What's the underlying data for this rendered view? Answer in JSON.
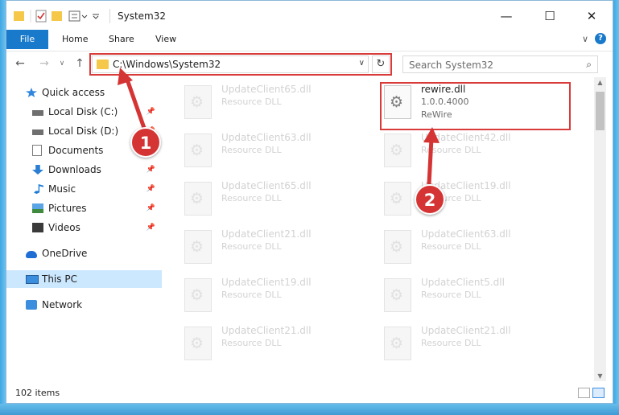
{
  "window": {
    "title": "System32",
    "minimize": "—",
    "maximize": "☐",
    "close": "✕"
  },
  "ribbon": {
    "tabs": [
      "File",
      "Home",
      "Share",
      "View"
    ],
    "expand": "∨",
    "help": "?"
  },
  "address": {
    "path": "C:\\Windows\\System32",
    "search_placeholder": "Search System32"
  },
  "navigation": [
    {
      "label": "Quick access",
      "icon": "star-icon"
    },
    {
      "label": "Local Disk (C:)",
      "icon": "drive-icon",
      "pinned": true
    },
    {
      "label": "Local Disk (D:)",
      "icon": "drive-icon",
      "pinned": true
    },
    {
      "label": "Documents",
      "icon": "document-icon",
      "pinned": true
    },
    {
      "label": "Downloads",
      "icon": "download-icon",
      "pinned": true
    },
    {
      "label": "Music",
      "icon": "music-icon",
      "pinned": true
    },
    {
      "label": "Pictures",
      "icon": "picture-icon",
      "pinned": true
    },
    {
      "label": "Videos",
      "icon": "video-icon",
      "pinned": true
    },
    {
      "label": "OneDrive",
      "icon": "cloud-icon"
    },
    {
      "label": "This PC",
      "icon": "computer-icon",
      "selected": true
    },
    {
      "label": "Network",
      "icon": "network-icon"
    }
  ],
  "files": [
    {
      "name": "UpdateClient65.dll",
      "desc": "Resource DLL"
    },
    {
      "name": "rewire.dll",
      "desc": "1.0.0.4000",
      "company": "ReWire",
      "active": true
    },
    {
      "name": "UpdateClient63.dll",
      "desc": "Resource DLL"
    },
    {
      "name": "UpdateClient42.dll",
      "desc": "Resource DLL"
    },
    {
      "name": "UpdateClient65.dll",
      "desc": "Resource DLL"
    },
    {
      "name": "UpdateClient19.dll",
      "desc": "Resource DLL"
    },
    {
      "name": "UpdateClient21.dll",
      "desc": "Resource DLL"
    },
    {
      "name": "UpdateClient63.dll",
      "desc": "Resource DLL"
    },
    {
      "name": "UpdateClient19.dll",
      "desc": "Resource DLL"
    },
    {
      "name": "UpdateClient5.dll",
      "desc": "Resource DLL"
    },
    {
      "name": "UpdateClient21.dll",
      "desc": "Resource DLL"
    },
    {
      "name": "UpdateClient21.dll",
      "desc": "Resource DLL"
    }
  ],
  "status": {
    "count": "102 items"
  },
  "annotations": {
    "badge1": "1",
    "badge2": "2",
    "color": "#d53434"
  }
}
